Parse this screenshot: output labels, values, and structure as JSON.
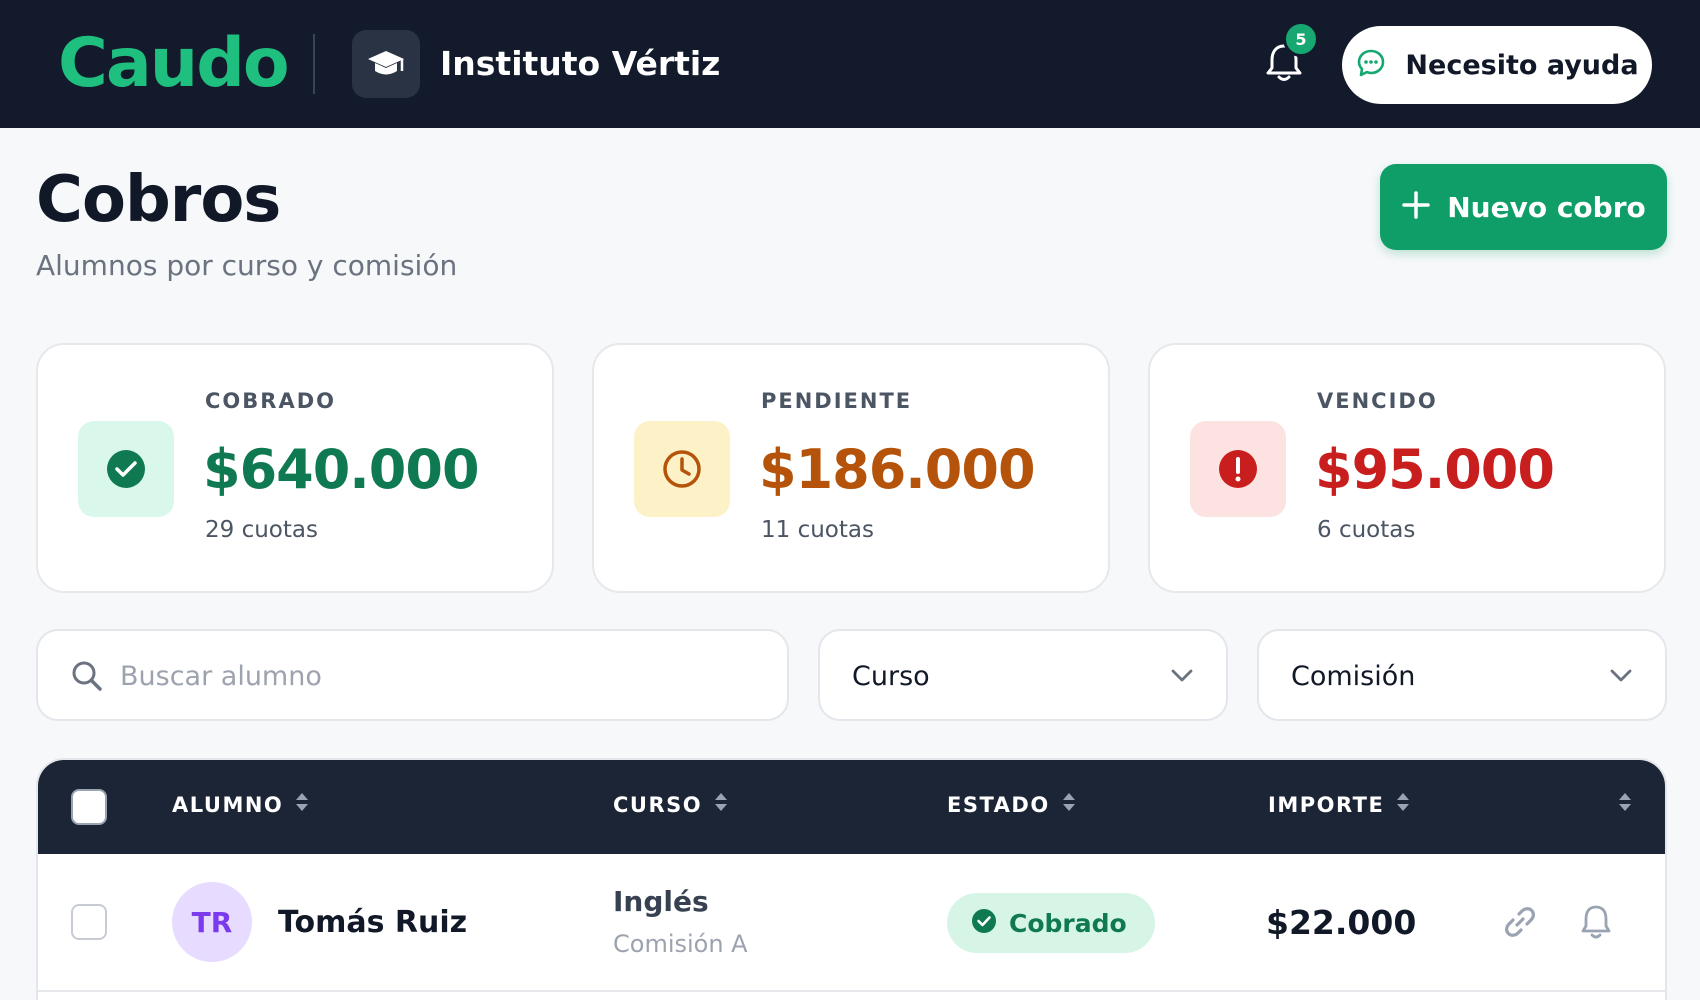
{
  "topbar": {
    "logo": "Caudo",
    "institution": "Instituto Vértiz",
    "notifications_count": "5",
    "help_label": "Necesito ayuda"
  },
  "header": {
    "title": "Cobros",
    "subtitle": "Alumnos por curso y comisión",
    "new_button_label": "Nuevo cobro"
  },
  "summary": {
    "collected": {
      "label": "COBRADO",
      "value": "$640.000",
      "sub": "29 cuotas",
      "color": "#0f7a52",
      "icon": "check-circle-icon"
    },
    "pending": {
      "label": "PENDIENTE",
      "value": "$186.000",
      "sub": "11 cuotas",
      "color": "#b45309",
      "icon": "clock-icon"
    },
    "overdue": {
      "label": "VENCIDO",
      "value": "$95.000",
      "sub": "6 cuotas",
      "color": "#c81e1e",
      "icon": "alert-icon"
    }
  },
  "filters": {
    "search_placeholder": "Buscar alumno",
    "course_select": "Curso",
    "commission_select": "Comisión"
  },
  "table": {
    "columns": [
      "ALUMNO",
      "CURSO",
      "ESTADO",
      "IMPORTE"
    ],
    "rows": [
      {
        "initials": "TR",
        "name": "Tomás Ruiz",
        "course": "Inglés",
        "commission": "Comisión A",
        "status": "Cobrado",
        "amount": "$22.000"
      }
    ]
  }
}
